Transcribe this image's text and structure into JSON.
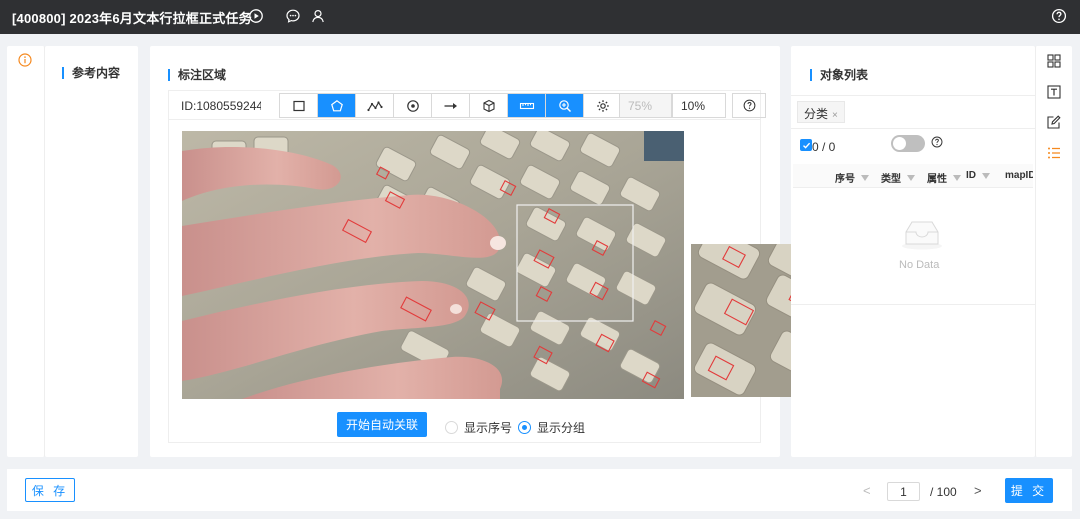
{
  "header": {
    "title": "[400800] 2023年6月文本行拉框正式任务",
    "icons": [
      "play-icon",
      "comment-icon",
      "user-icon",
      "help-icon"
    ]
  },
  "reference": {
    "title": "参考内容"
  },
  "annotation": {
    "title": "标注区域",
    "id_label": "ID:1080559244",
    "tools": [
      "rectangle-tool",
      "polygon-tool",
      "polyline-tool",
      "point-tool",
      "arrow-tool",
      "cube-tool",
      "ruler-tool",
      "zoom-in-tool",
      "settings-tool"
    ],
    "active_tools": [
      "polygon-tool",
      "ruler-tool",
      "zoom-in-tool"
    ],
    "zoom_readonly": "75%",
    "zoom_value": "10%",
    "auto_link_button": "开始自动关联",
    "radio_show_index": "显示序号",
    "radio_show_group": "显示分组",
    "selected_radio": "显示分组"
  },
  "objects": {
    "title": "对象列表",
    "tag": "分类",
    "tag_close": "×",
    "count": "0 / 0",
    "columns": [
      "序号",
      "类型",
      "属性",
      "ID",
      "mapID"
    ],
    "empty_text": "No Data"
  },
  "side_tools": [
    "grid-icon",
    "text-icon",
    "edit-icon",
    "list-icon"
  ],
  "footer": {
    "save_button": "保 存",
    "page_current": "1",
    "page_total": "/ 100",
    "prev": "<",
    "next": ">",
    "submit_button": "提 交"
  },
  "colors": {
    "accent": "#1890ff",
    "header_bg": "#2f3033",
    "info_orange": "#f5891f"
  }
}
